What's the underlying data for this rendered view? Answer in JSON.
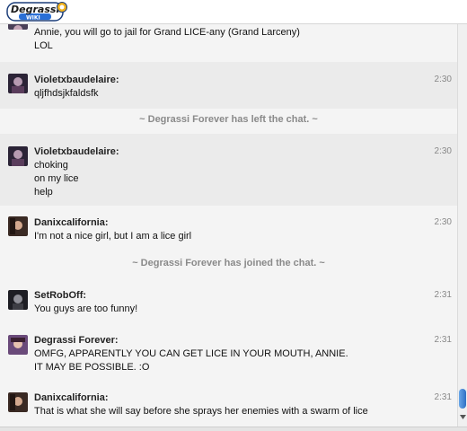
{
  "header": {
    "logo_text": "Degrassi",
    "logo_sub": "WIKI"
  },
  "chat": {
    "messages": [
      {
        "user": "",
        "time": "",
        "lines": [
          "Annie, you will go to jail for Grand LICE-any (Grand Larceny)",
          "LOL"
        ]
      },
      {
        "user": "Violetxbaudelaire:",
        "time": "2:30",
        "lines": [
          "qljfhdsjkfaldsfk"
        ]
      },
      {
        "system": "~ Degrassi Forever has left the chat. ~"
      },
      {
        "user": "Violetxbaudelaire:",
        "time": "2:30",
        "lines": [
          "choking",
          "on my lice",
          "help"
        ]
      },
      {
        "user": "Danixcalifornia:",
        "time": "2:30",
        "lines": [
          "I'm not a nice girl, but I am a lice girl"
        ]
      },
      {
        "system": "~ Degrassi Forever has joined the chat. ~"
      },
      {
        "user": "SetRobOff:",
        "time": "2:31",
        "lines": [
          "You guys are too funny!"
        ]
      },
      {
        "user": "Degrassi Forever:",
        "time": "2:31",
        "lines": [
          "OMFG, APPARENTLY YOU CAN GET LICE IN YOUR MOUTH, ANNIE.",
          "IT MAY BE POSSIBLE. :O"
        ]
      },
      {
        "user": "Danixcalifornia:",
        "time": "2:31",
        "lines": [
          "That is what she will say before she sprays her enemies with a swarm of lice"
        ]
      }
    ]
  },
  "colors": {
    "alt_row": "#ebebeb",
    "row": "#f4f4f4",
    "system_text": "#8a8a8a",
    "scroll_thumb": "#2f6fc4"
  }
}
